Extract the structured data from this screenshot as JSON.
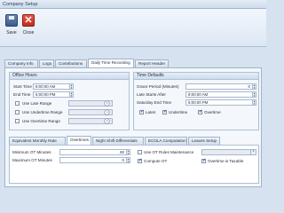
{
  "window": {
    "title": "Company Setup"
  },
  "ribbon": {
    "save_label": "Save",
    "close_label": "Close"
  },
  "tabs": [
    {
      "label": "Company Info"
    },
    {
      "label": "Logo"
    },
    {
      "label": "Contributions"
    },
    {
      "label": "Daily Time Recording"
    },
    {
      "label": "Report Header"
    }
  ],
  "office_hours": {
    "header": "Office Hours",
    "start_label": "Start Time",
    "start_value": "8:00:00 AM",
    "end_label": "End Time",
    "end_value": "5:00:00 PM",
    "late_range": "Use Late Range",
    "undertime_range": "Use Undertime Range",
    "overtime_range": "Use Overtime Range"
  },
  "time_defaults": {
    "header": "Time Defaults",
    "grace_label": "Grace Period (Minutes)",
    "grace_value": "0",
    "late_after_label": "Late Starts After",
    "late_after_value": "8:00:00 AM",
    "sat_end_label": "Saturday End Time",
    "sat_end_value": "5:00:00 PM",
    "lates": "Lates",
    "undertime": "Undertime",
    "overtime": "Overtime"
  },
  "sub_tabs": [
    {
      "label": "Equivalent Monthly Rate"
    },
    {
      "label": "Overtimes"
    },
    {
      "label": "Night Shift Differentials"
    },
    {
      "label": "ECOLA Computation"
    },
    {
      "label": "Leaves Setup"
    }
  ],
  "overtimes": {
    "min_label": "Minimum OT Minutes",
    "min_value": "60",
    "max_label": "Maximum OT Minutes",
    "max_value": "0",
    "ot_rules": "Use OT Rules Maintenance",
    "compute_ot": "Compute OT",
    "taxable": "Overtime is Taxable"
  }
}
